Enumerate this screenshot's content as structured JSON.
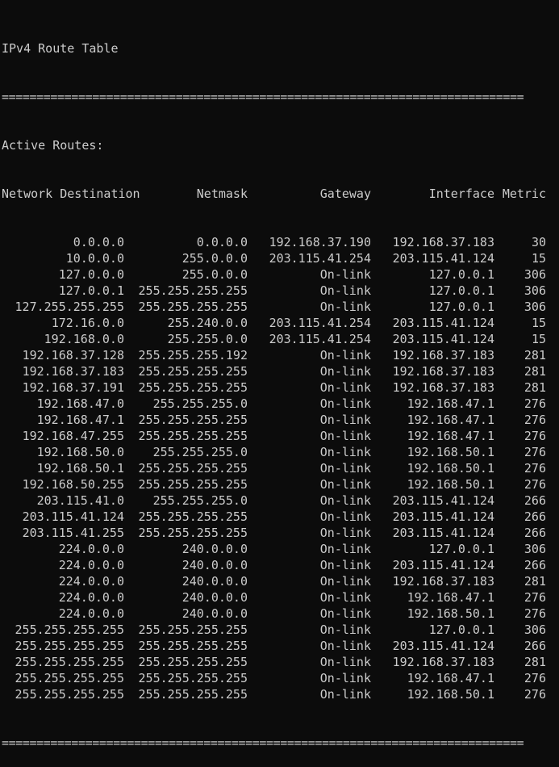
{
  "title": "IPv4 Route Table",
  "separator": "===========================================================================",
  "section_label": "Active Routes:",
  "columns": {
    "destination": "Network Destination",
    "netmask": "Netmask",
    "gateway": "Gateway",
    "interface": "Interface",
    "metric": "Metric"
  },
  "routes": [
    {
      "dest": "0.0.0.0",
      "mask": "0.0.0.0",
      "gw": "192.168.37.190",
      "iface": "192.168.37.183",
      "metric": "30"
    },
    {
      "dest": "10.0.0.0",
      "mask": "255.0.0.0",
      "gw": "203.115.41.254",
      "iface": "203.115.41.124",
      "metric": "15"
    },
    {
      "dest": "127.0.0.0",
      "mask": "255.0.0.0",
      "gw": "On-link",
      "iface": "127.0.0.1",
      "metric": "306"
    },
    {
      "dest": "127.0.0.1",
      "mask": "255.255.255.255",
      "gw": "On-link",
      "iface": "127.0.0.1",
      "metric": "306"
    },
    {
      "dest": "127.255.255.255",
      "mask": "255.255.255.255",
      "gw": "On-link",
      "iface": "127.0.0.1",
      "metric": "306"
    },
    {
      "dest": "172.16.0.0",
      "mask": "255.240.0.0",
      "gw": "203.115.41.254",
      "iface": "203.115.41.124",
      "metric": "15"
    },
    {
      "dest": "192.168.0.0",
      "mask": "255.255.0.0",
      "gw": "203.115.41.254",
      "iface": "203.115.41.124",
      "metric": "15"
    },
    {
      "dest": "192.168.37.128",
      "mask": "255.255.255.192",
      "gw": "On-link",
      "iface": "192.168.37.183",
      "metric": "281"
    },
    {
      "dest": "192.168.37.183",
      "mask": "255.255.255.255",
      "gw": "On-link",
      "iface": "192.168.37.183",
      "metric": "281"
    },
    {
      "dest": "192.168.37.191",
      "mask": "255.255.255.255",
      "gw": "On-link",
      "iface": "192.168.37.183",
      "metric": "281"
    },
    {
      "dest": "192.168.47.0",
      "mask": "255.255.255.0",
      "gw": "On-link",
      "iface": "192.168.47.1",
      "metric": "276"
    },
    {
      "dest": "192.168.47.1",
      "mask": "255.255.255.255",
      "gw": "On-link",
      "iface": "192.168.47.1",
      "metric": "276"
    },
    {
      "dest": "192.168.47.255",
      "mask": "255.255.255.255",
      "gw": "On-link",
      "iface": "192.168.47.1",
      "metric": "276"
    },
    {
      "dest": "192.168.50.0",
      "mask": "255.255.255.0",
      "gw": "On-link",
      "iface": "192.168.50.1",
      "metric": "276"
    },
    {
      "dest": "192.168.50.1",
      "mask": "255.255.255.255",
      "gw": "On-link",
      "iface": "192.168.50.1",
      "metric": "276"
    },
    {
      "dest": "192.168.50.255",
      "mask": "255.255.255.255",
      "gw": "On-link",
      "iface": "192.168.50.1",
      "metric": "276"
    },
    {
      "dest": "203.115.41.0",
      "mask": "255.255.255.0",
      "gw": "On-link",
      "iface": "203.115.41.124",
      "metric": "266"
    },
    {
      "dest": "203.115.41.124",
      "mask": "255.255.255.255",
      "gw": "On-link",
      "iface": "203.115.41.124",
      "metric": "266"
    },
    {
      "dest": "203.115.41.255",
      "mask": "255.255.255.255",
      "gw": "On-link",
      "iface": "203.115.41.124",
      "metric": "266"
    },
    {
      "dest": "224.0.0.0",
      "mask": "240.0.0.0",
      "gw": "On-link",
      "iface": "127.0.0.1",
      "metric": "306"
    },
    {
      "dest": "224.0.0.0",
      "mask": "240.0.0.0",
      "gw": "On-link",
      "iface": "203.115.41.124",
      "metric": "266"
    },
    {
      "dest": "224.0.0.0",
      "mask": "240.0.0.0",
      "gw": "On-link",
      "iface": "192.168.37.183",
      "metric": "281"
    },
    {
      "dest": "224.0.0.0",
      "mask": "240.0.0.0",
      "gw": "On-link",
      "iface": "192.168.47.1",
      "metric": "276"
    },
    {
      "dest": "224.0.0.0",
      "mask": "240.0.0.0",
      "gw": "On-link",
      "iface": "192.168.50.1",
      "metric": "276"
    },
    {
      "dest": "255.255.255.255",
      "mask": "255.255.255.255",
      "gw": "On-link",
      "iface": "127.0.0.1",
      "metric": "306"
    },
    {
      "dest": "255.255.255.255",
      "mask": "255.255.255.255",
      "gw": "On-link",
      "iface": "203.115.41.124",
      "metric": "266"
    },
    {
      "dest": "255.255.255.255",
      "mask": "255.255.255.255",
      "gw": "On-link",
      "iface": "192.168.37.183",
      "metric": "281"
    },
    {
      "dest": "255.255.255.255",
      "mask": "255.255.255.255",
      "gw": "On-link",
      "iface": "192.168.47.1",
      "metric": "276"
    },
    {
      "dest": "255.255.255.255",
      "mask": "255.255.255.255",
      "gw": "On-link",
      "iface": "192.168.50.1",
      "metric": "276"
    }
  ],
  "colors": {
    "background": "#0c0c0c",
    "text": "#cccccc"
  }
}
